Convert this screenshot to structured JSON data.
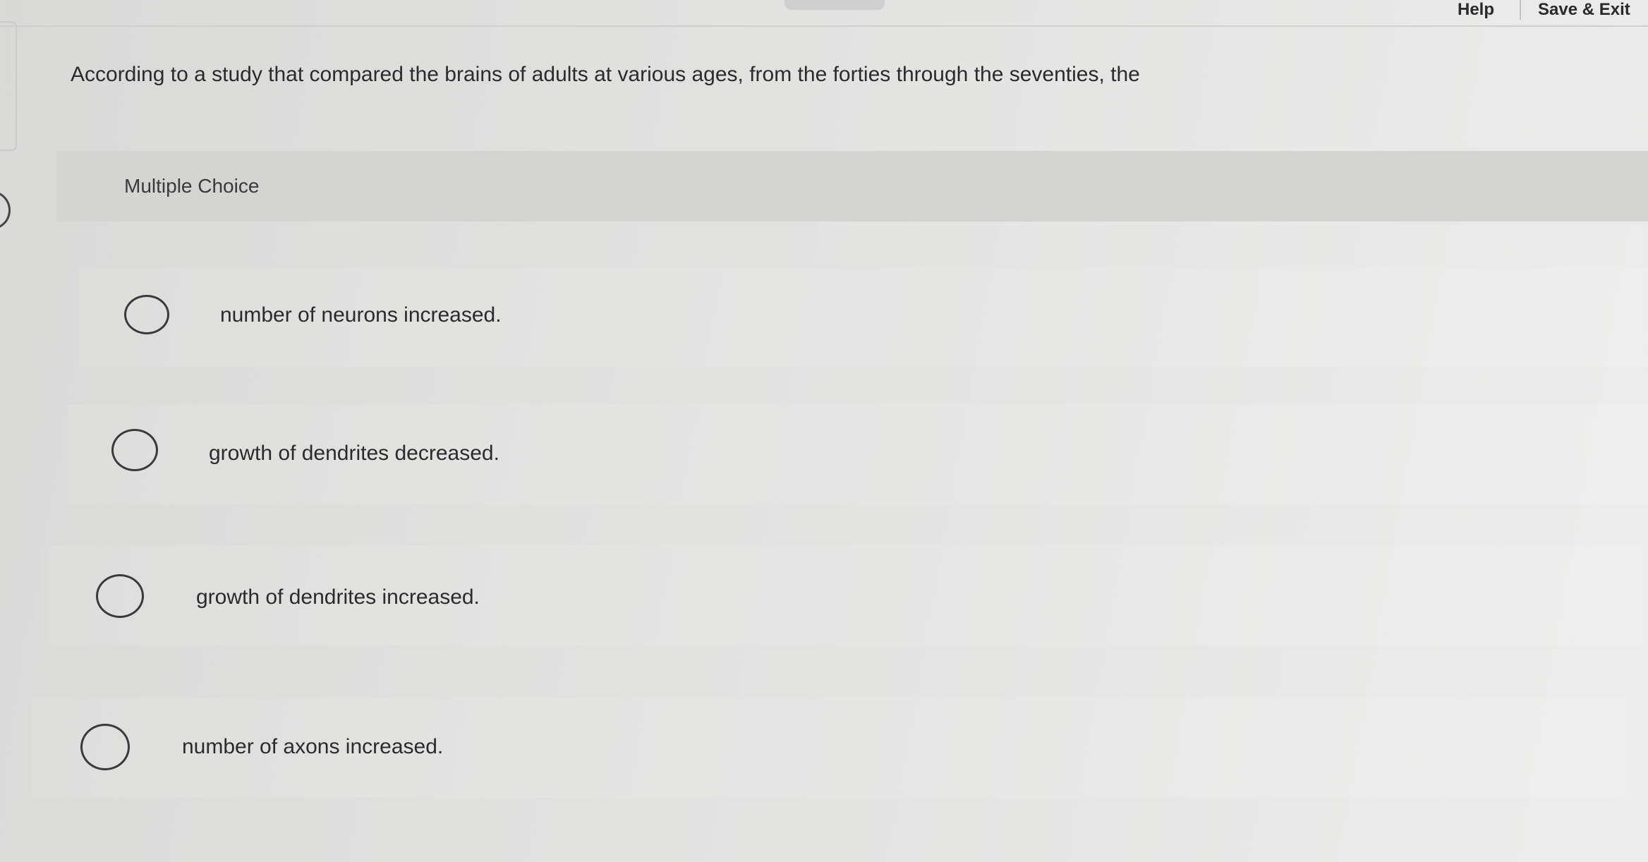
{
  "toolbar": {
    "help_label": "Help",
    "save_exit_label": "Save & Exit"
  },
  "question": {
    "text": "According to a study that compared the brains of adults at various ages, from the forties through the seventies, the"
  },
  "question_type": "Multiple Choice",
  "options": [
    {
      "label": "number of neurons increased.",
      "selected": false
    },
    {
      "label": "growth of dendrites decreased.",
      "selected": false
    },
    {
      "label": "growth of dendrites increased.",
      "selected": false
    },
    {
      "label": "number of axons increased.",
      "selected": false
    }
  ]
}
